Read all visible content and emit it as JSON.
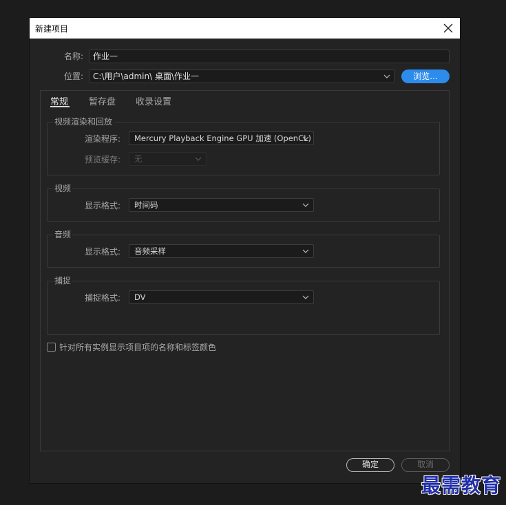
{
  "dialog": {
    "title": "新建项目"
  },
  "form": {
    "name_label": "名称:",
    "name_value": "作业一",
    "location_label": "位置:",
    "location_value": "C:\\用户\\admin\\ 桌面\\作业一",
    "browse_label": "浏览..."
  },
  "tabs": [
    {
      "label": "常规",
      "active": true
    },
    {
      "label": "暂存盘",
      "active": false
    },
    {
      "label": "收录设置",
      "active": false
    }
  ],
  "groups": {
    "video_render": {
      "title": "视频渲染和回放",
      "renderer_label": "渲染程序:",
      "renderer_value": "Mercury Playback Engine GPU 加速 (OpenCL)",
      "preview_cache_label": "预览缓存:",
      "preview_cache_value": "无"
    },
    "video": {
      "title": "视频",
      "format_label": "显示格式:",
      "format_value": "时间码"
    },
    "audio": {
      "title": "音频",
      "format_label": "显示格式:",
      "format_value": "音频采样"
    },
    "capture": {
      "title": "捕捉",
      "format_label": "捕捉格式:",
      "format_value": "DV"
    }
  },
  "checkbox": {
    "label": "针对所有实例显示项目项的名称和标签颜色",
    "checked": false
  },
  "footer": {
    "ok_label": "确定",
    "cancel_label": "取消"
  },
  "watermark": "最需教育",
  "colors": {
    "accent": "#2d8ceb",
    "background": "#232323",
    "titlebar": "#ffffff",
    "watermark": "#2230a8"
  }
}
